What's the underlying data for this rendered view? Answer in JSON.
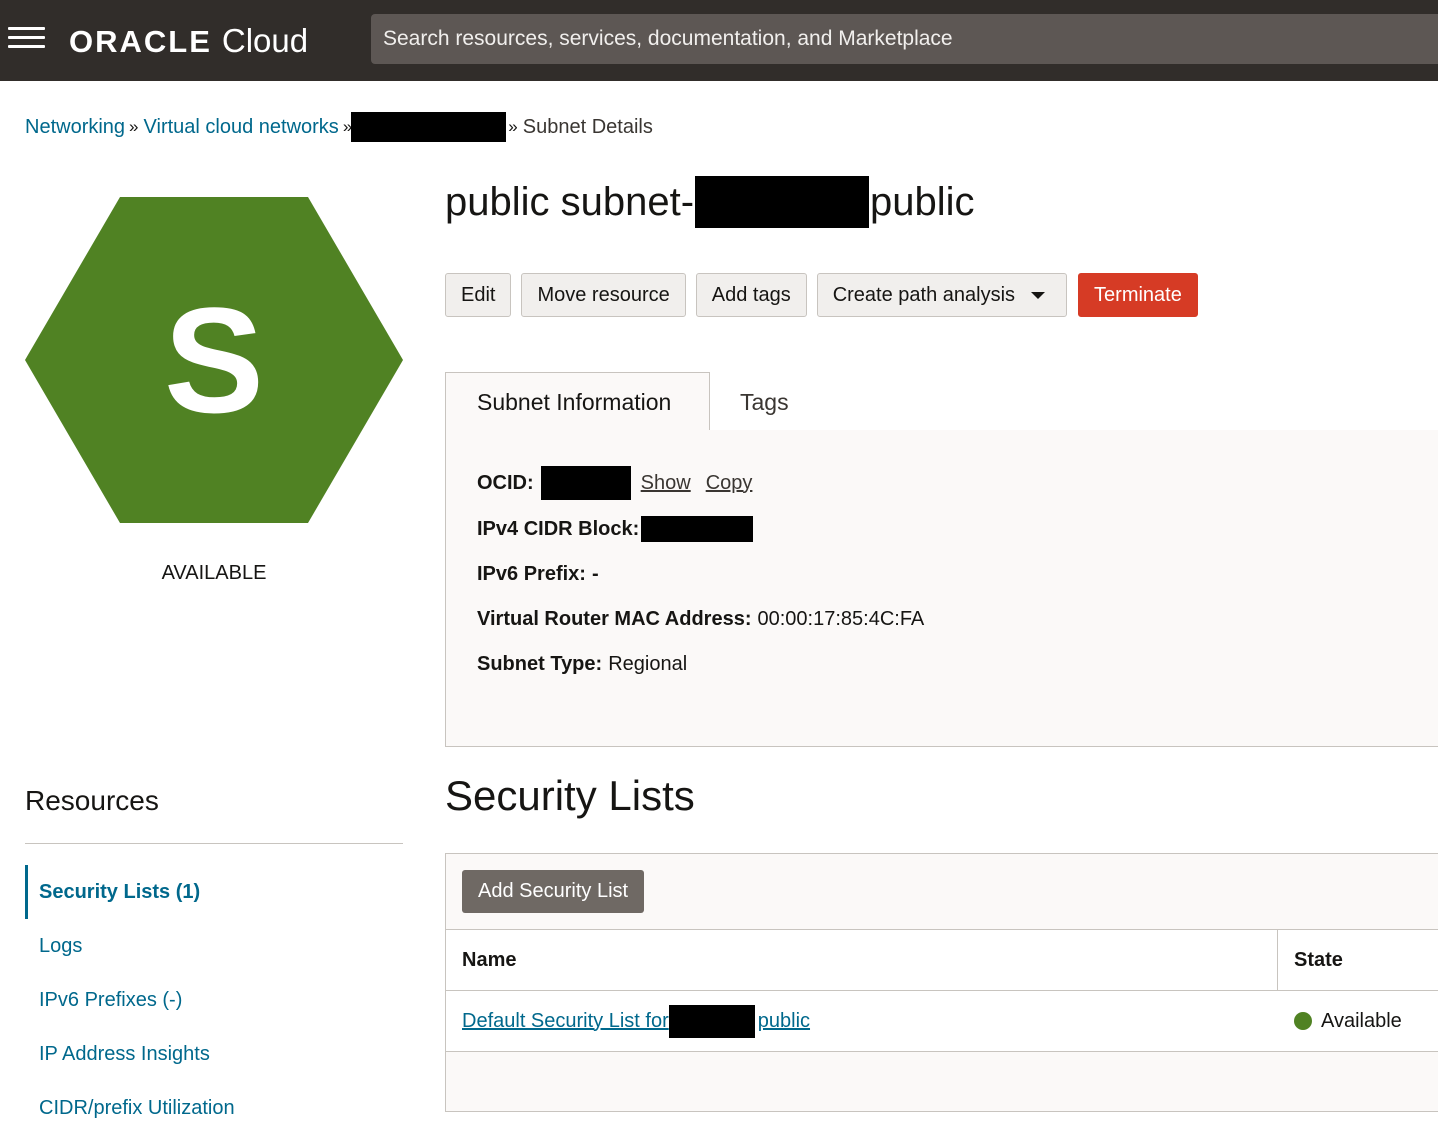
{
  "topbar": {
    "brand": "ORACLE",
    "product": "Cloud",
    "search_placeholder": "Search resources, services, documentation, and Marketplace"
  },
  "breadcrumb": {
    "items": [
      "Networking",
      "Virtual cloud networks"
    ],
    "separator": "»",
    "current": "Subnet Details"
  },
  "resource_icon": {
    "letter": "S",
    "color": "#508223",
    "status": "AVAILABLE"
  },
  "title": {
    "prefix": "public subnet-",
    "suffix": "public"
  },
  "actions": {
    "edit": "Edit",
    "move": "Move resource",
    "add_tags": "Add tags",
    "path_analysis": "Create path analysis",
    "terminate": "Terminate",
    "terminate_color": "#d63b25"
  },
  "tabs": {
    "info": "Subnet Information",
    "tags": "Tags"
  },
  "info": {
    "ocid_label": "OCID:",
    "show": "Show",
    "copy": "Copy",
    "ipv4_label": "IPv4 CIDR Block:",
    "ipv6_label": "IPv6 Prefix:",
    "ipv6_value": "-",
    "mac_label": "Virtual Router MAC Address:",
    "mac_value": "00:00:17:85:4C:FA",
    "type_label": "Subnet Type:",
    "type_value": "Regional"
  },
  "resources": {
    "title": "Resources",
    "items": [
      "Security Lists (1)",
      "Logs",
      "IPv6 Prefixes (-)",
      "IP Address Insights",
      "CIDR/prefix Utilization"
    ]
  },
  "security_lists": {
    "title": "Security Lists",
    "add_button": "Add Security List",
    "columns": [
      "Name",
      "State"
    ],
    "rows": [
      {
        "name_prefix": "Default Security List for",
        "name_suffix": "public",
        "state": "Available",
        "state_color": "#508223"
      }
    ]
  }
}
